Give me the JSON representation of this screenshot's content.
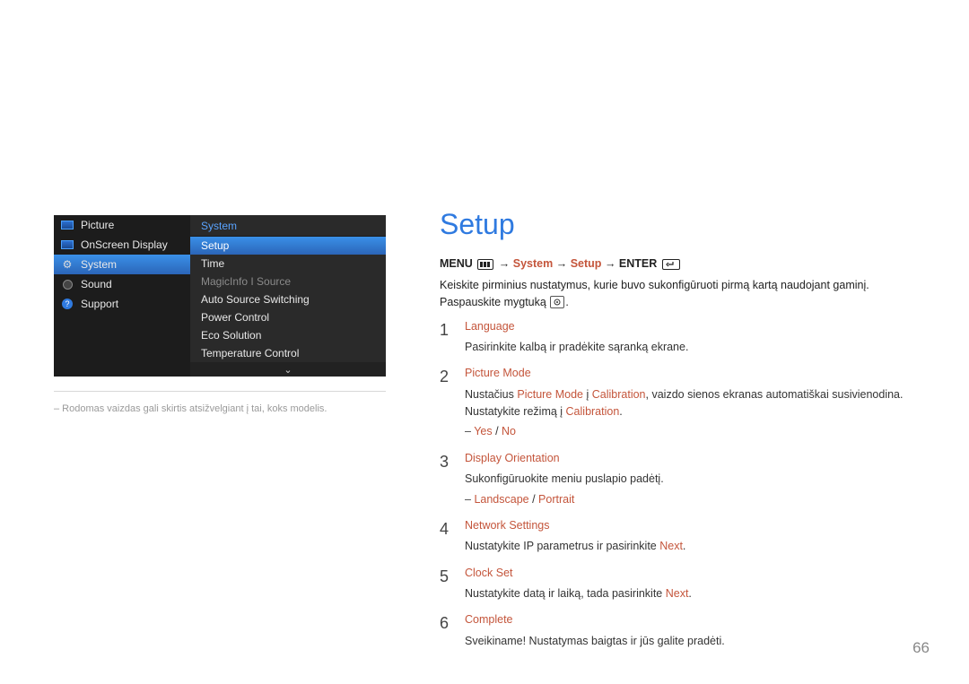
{
  "osd": {
    "left": [
      {
        "label": "Picture",
        "icon": "picture-icon",
        "selected": false
      },
      {
        "label": "OnScreen Display",
        "icon": "picture-icon",
        "selected": false
      },
      {
        "label": "System",
        "icon": "gear-icon",
        "selected": true
      },
      {
        "label": "Sound",
        "icon": "sound-icon",
        "selected": false
      },
      {
        "label": "Support",
        "icon": "help-icon",
        "selected": false
      }
    ],
    "right_title": "System",
    "right": [
      {
        "label": "Setup",
        "state": "highlight"
      },
      {
        "label": "Time",
        "state": "normal"
      },
      {
        "label": "MagicInfo I Source",
        "state": "dim"
      },
      {
        "label": "Auto Source Switching",
        "state": "normal"
      },
      {
        "label": "Power Control",
        "state": "normal"
      },
      {
        "label": "Eco Solution",
        "state": "normal"
      },
      {
        "label": "Temperature Control",
        "state": "normal"
      }
    ],
    "chevron": "⌄"
  },
  "osd_note": "–  Rodomas vaizdas gali skirtis atsižvelgiant į tai, koks modelis.",
  "title": "Setup",
  "breadcrumb": {
    "menu": "MENU",
    "arrow": "→",
    "system": "System",
    "setup": "Setup",
    "enter": "ENTER"
  },
  "intro_a": "Keiskite pirminius nustatymus, kurie buvo sukonfigūruoti pirmą kartą naudojant gaminį. Paspauskite",
  "intro_b": "mygtuką",
  "intro_c": ".",
  "steps": [
    {
      "title": "Language",
      "lines": [
        {
          "text": "Pasirinkite kalbą ir pradėkite sąranką ekrane."
        }
      ]
    },
    {
      "title": "Picture Mode",
      "lines": [
        {
          "html_parts": [
            {
              "t": "Nustačius "
            },
            {
              "t": "Picture Mode",
              "orange": true
            },
            {
              "t": " į "
            },
            {
              "t": "Calibration",
              "orange": true
            },
            {
              "t": ", vaizdo sienos ekranas automatiškai susivienodina. Nustatykite režimą į "
            },
            {
              "t": "Calibration",
              "orange": true
            },
            {
              "t": "."
            }
          ]
        },
        {
          "sub": true,
          "html_parts": [
            {
              "t": "Yes",
              "orange": true
            },
            {
              "t": " / "
            },
            {
              "t": "No",
              "orange": true
            }
          ]
        }
      ]
    },
    {
      "title": "Display Orientation",
      "lines": [
        {
          "text": "Sukonfigūruokite meniu puslapio padėtį."
        },
        {
          "sub": true,
          "html_parts": [
            {
              "t": "Landscape",
              "orange": true
            },
            {
              "t": " / "
            },
            {
              "t": "Portrait",
              "orange": true
            }
          ]
        }
      ]
    },
    {
      "title": "Network Settings",
      "lines": [
        {
          "html_parts": [
            {
              "t": "Nustatykite IP parametrus ir pasirinkite "
            },
            {
              "t": "Next",
              "orange": true
            },
            {
              "t": "."
            }
          ]
        }
      ]
    },
    {
      "title": "Clock Set",
      "lines": [
        {
          "html_parts": [
            {
              "t": "Nustatykite datą ir laiką, tada pasirinkite "
            },
            {
              "t": "Next",
              "orange": true
            },
            {
              "t": "."
            }
          ]
        }
      ]
    },
    {
      "title": "Complete",
      "lines": [
        {
          "text": "Sveikiname! Nustatymas baigtas ir jūs galite pradėti."
        }
      ]
    }
  ],
  "page_number": "66"
}
